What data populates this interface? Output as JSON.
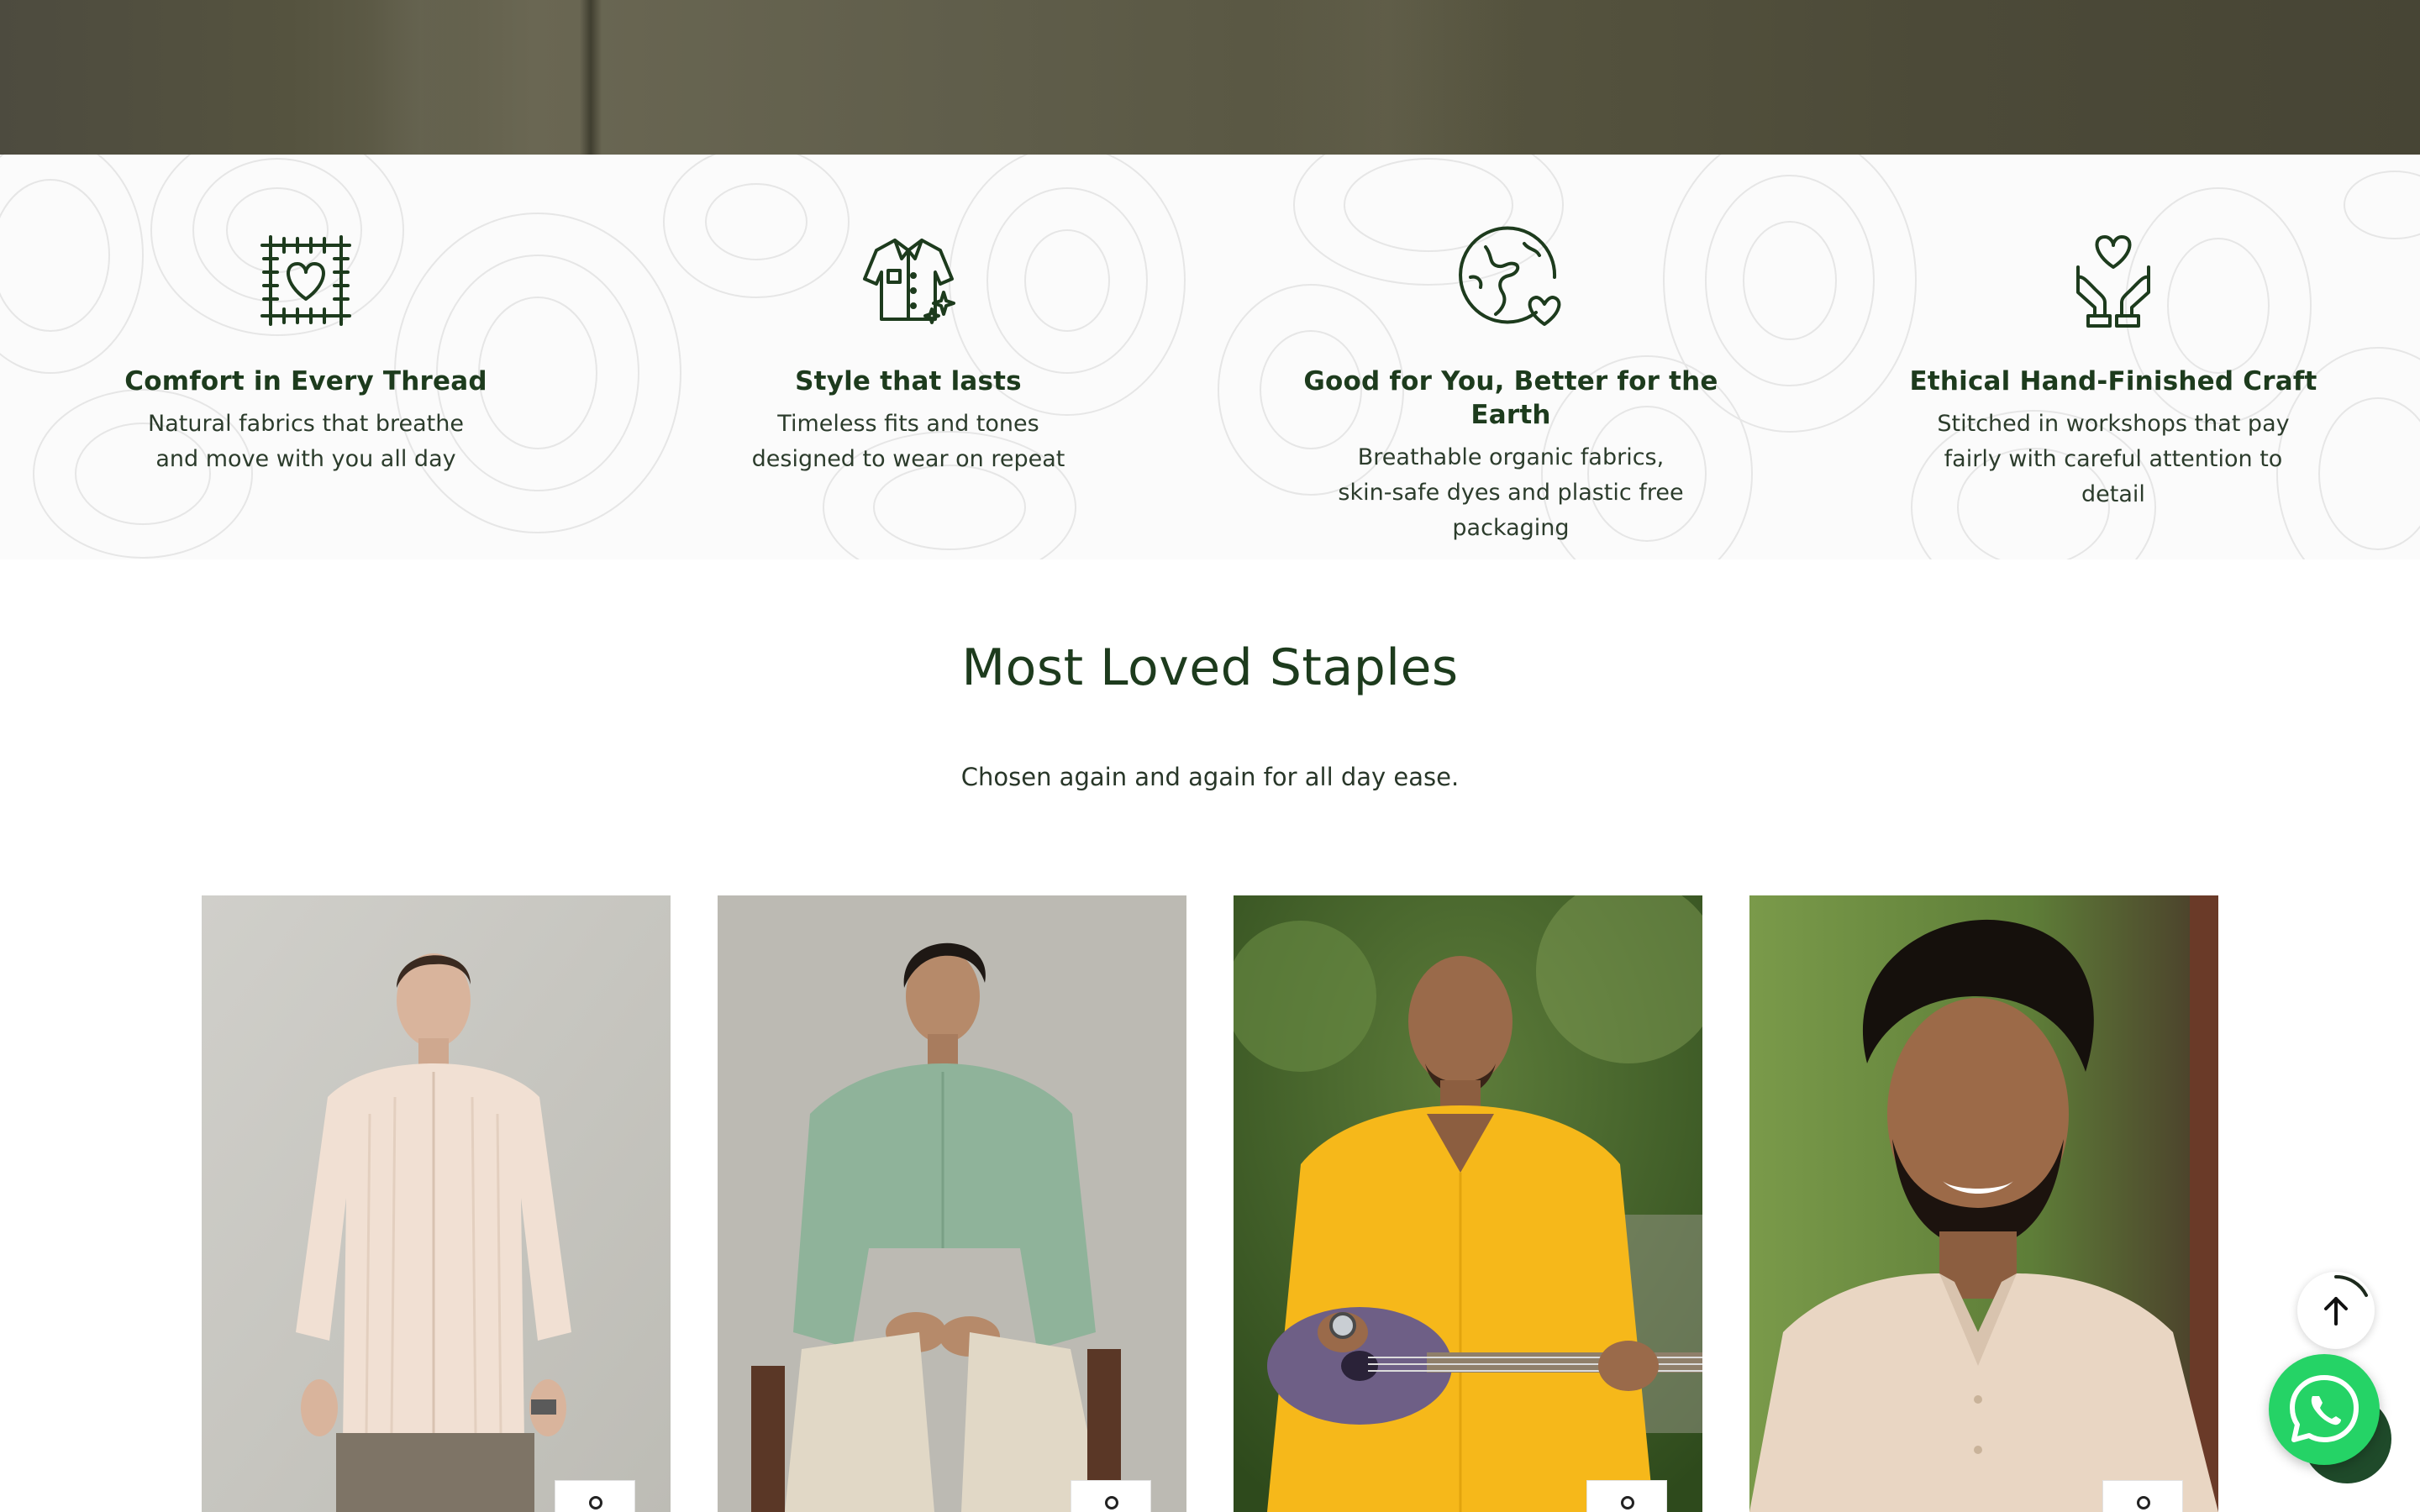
{
  "features": [
    {
      "title": "Comfort in Every Thread",
      "desc": "Natural fabrics that breathe and move with you all day",
      "icon": "fabric-heart-icon"
    },
    {
      "title": "Style that lasts",
      "desc": "Timeless fits and tones designed to wear on repeat",
      "icon": "shirt-sparkle-icon"
    },
    {
      "title": "Good for You, Better for the Earth",
      "desc": "Breathable organic fabrics, skin-safe dyes and plastic free packaging",
      "icon": "earth-heart-icon"
    },
    {
      "title": "Ethical Hand-Finished Craft",
      "desc": "Stitched in workshops that pay fairly with careful attention to detail",
      "icon": "hands-heart-icon"
    }
  ],
  "section": {
    "title": "Most Loved Staples",
    "subtitle": "Chosen again and again for all day ease."
  },
  "products": [
    {
      "id": "card-1",
      "shirt_color": "#f1e0d3",
      "bg": "#c8c7c1"
    },
    {
      "id": "card-2",
      "shirt_color": "#8fb39a",
      "bg": "#bdbab4"
    },
    {
      "id": "card-3",
      "shirt_color": "#f6b81a",
      "bg": "#4b6b2f"
    },
    {
      "id": "card-4",
      "shirt_color": "#e9d6c3",
      "bg": "#6f8a45"
    }
  ],
  "colors": {
    "accent": "#1d3b1d",
    "whatsapp": "#25d366"
  },
  "floating": {
    "scroll_top_icon": "arrow-up-icon",
    "chat_icon": "whatsapp-icon"
  }
}
